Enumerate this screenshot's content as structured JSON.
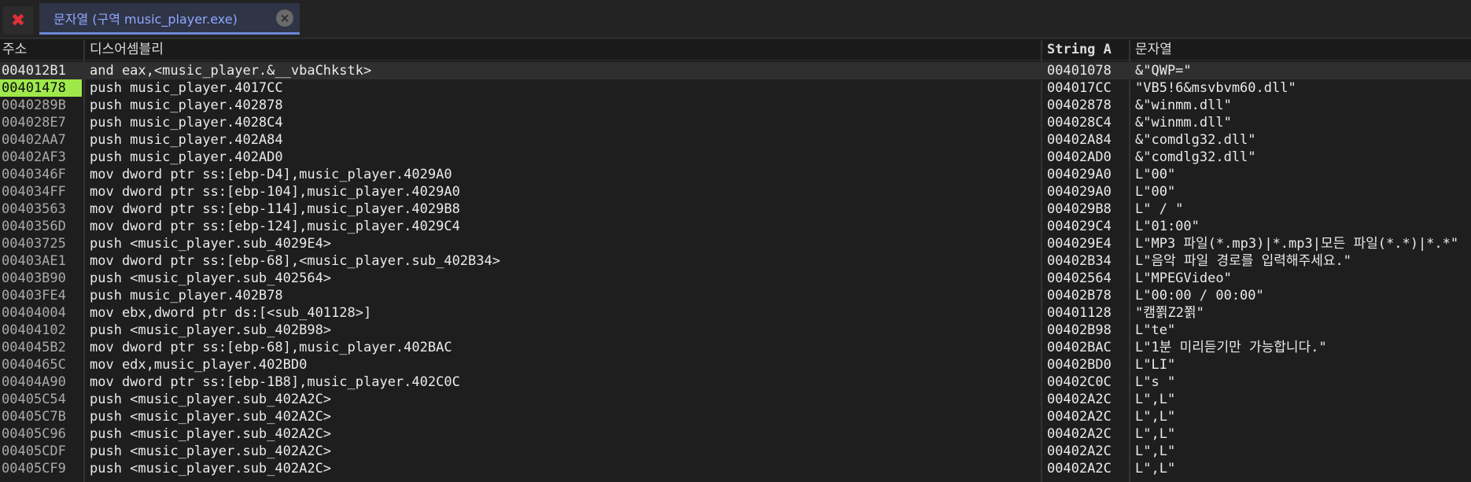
{
  "tabbar": {
    "close_icon": "close-x-icon",
    "tab_label": "문자열 (구역 music_player.exe)",
    "tab_close_glyph": "×"
  },
  "columns": {
    "address": "주소",
    "disassembly": "디스어셈블리",
    "string_address": "String A",
    "string": "문자열"
  },
  "rows": [
    {
      "addr": "004012B1",
      "dis": "and eax,<music_player.&__vbaChkstk>",
      "saddr": "00401078",
      "str": "&\"QWP=\""
    },
    {
      "addr": "00401478",
      "dis": "push music_player.4017CC",
      "saddr": "004017CC",
      "str": "\"VB5!6&msvbvm60.dll\""
    },
    {
      "addr": "0040289B",
      "dis": "push music_player.402878",
      "saddr": "00402878",
      "str": "&\"winmm.dll\""
    },
    {
      "addr": "004028E7",
      "dis": "push music_player.4028C4",
      "saddr": "004028C4",
      "str": "&\"winmm.dll\""
    },
    {
      "addr": "00402AA7",
      "dis": "push music_player.402A84",
      "saddr": "00402A84",
      "str": "&\"comdlg32.dll\""
    },
    {
      "addr": "00402AF3",
      "dis": "push music_player.402AD0",
      "saddr": "00402AD0",
      "str": "&\"comdlg32.dll\""
    },
    {
      "addr": "0040346F",
      "dis": "mov dword ptr ss:[ebp-D4],music_player.4029A0",
      "saddr": "004029A0",
      "str": "L\"00\""
    },
    {
      "addr": "004034FF",
      "dis": "mov dword ptr ss:[ebp-104],music_player.4029A0",
      "saddr": "004029A0",
      "str": "L\"00\""
    },
    {
      "addr": "00403563",
      "dis": "mov dword ptr ss:[ebp-114],music_player.4029B8",
      "saddr": "004029B8",
      "str": "L\" / \""
    },
    {
      "addr": "0040356D",
      "dis": "mov dword ptr ss:[ebp-124],music_player.4029C4",
      "saddr": "004029C4",
      "str": "L\"01:00\""
    },
    {
      "addr": "00403725",
      "dis": "push <music_player.sub_4029E4>",
      "saddr": "004029E4",
      "str": "L\"MP3 파일(*.mp3)|*.mp3|모든 파일(*.*)|*.*\""
    },
    {
      "addr": "00403AE1",
      "dis": "mov dword ptr ss:[ebp-68],<music_player.sub_402B34>",
      "saddr": "00402B34",
      "str": "L\"음악 파일 경로를 입력해주세요.\""
    },
    {
      "addr": "00403B90",
      "dis": "push <music_player.sub_402564>",
      "saddr": "00402564",
      "str": "L\"MPEGVideo\""
    },
    {
      "addr": "00403FE4",
      "dis": "push music_player.402B78",
      "saddr": "00402B78",
      "str": "L\"00:00 / 00:00\""
    },
    {
      "addr": "00404004",
      "dis": "mov ebx,dword ptr ds:[<sub_401128>]",
      "saddr": "00401128",
      "str": "\"캠쬙Z2쬙\""
    },
    {
      "addr": "00404102",
      "dis": "push <music_player.sub_402B98>",
      "saddr": "00402B98",
      "str": "L\"te\""
    },
    {
      "addr": "004045B2",
      "dis": "mov dword ptr ss:[ebp-68],music_player.402BAC",
      "saddr": "00402BAC",
      "str": "L\"1분 미리듣기만 가능합니다.\""
    },
    {
      "addr": "0040465C",
      "dis": "mov edx,music_player.402BD0",
      "saddr": "00402BD0",
      "str": "L\"LI\""
    },
    {
      "addr": "00404A90",
      "dis": "mov dword ptr ss:[ebp-1B8],music_player.402C0C",
      "saddr": "00402C0C",
      "str": "L\"s \""
    },
    {
      "addr": "00405C54",
      "dis": "push <music_player.sub_402A2C>",
      "saddr": "00402A2C",
      "str": "L\",L\""
    },
    {
      "addr": "00405C7B",
      "dis": "push <music_player.sub_402A2C>",
      "saddr": "00402A2C",
      "str": "L\",L\""
    },
    {
      "addr": "00405C96",
      "dis": "push <music_player.sub_402A2C>",
      "saddr": "00402A2C",
      "str": "L\",L\""
    },
    {
      "addr": "00405CDF",
      "dis": "push <music_player.sub_402A2C>",
      "saddr": "00402A2C",
      "str": "L\",L\""
    },
    {
      "addr": "00405CF9",
      "dis": "push <music_player.sub_402A2C>",
      "saddr": "00402A2C",
      "str": "L\",L\""
    }
  ],
  "colors": {
    "background": "#1e1e1e",
    "address_highlight": "#9fe84a",
    "tab_accent": "#6e86d8",
    "close_red": "#e0303a"
  }
}
